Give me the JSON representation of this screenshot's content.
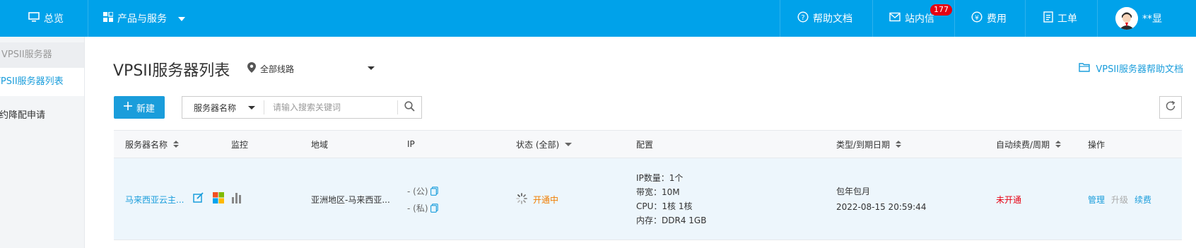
{
  "topbar": {
    "overview": "总览",
    "products": "产品与服务",
    "help_docs": "帮助文档",
    "messages": "站内信",
    "message_count": "177",
    "billing": "费用",
    "tickets": "工单",
    "username": "**显"
  },
  "sidebar": {
    "section": "VPSII服务器",
    "items": [
      {
        "label": "VPSII服务器列表"
      },
      {
        "label": "预约降配申请"
      }
    ]
  },
  "page": {
    "title": "VPSII服务器列表",
    "region": "全部线路",
    "help_link": "VPSII服务器帮助文档"
  },
  "toolbar": {
    "new_label": "新建",
    "search_field": "服务器名称",
    "search_placeholder": "请输入搜索关键词"
  },
  "table": {
    "headers": {
      "name": "服务器名称",
      "monitor": "监控",
      "region": "地域",
      "ip": "IP",
      "status": "状态 (全部)",
      "config": "配置",
      "type_expiry": "类型/到期日期",
      "auto_renew": "自动续费/周期",
      "actions": "操作"
    },
    "rows": [
      {
        "name": "马来西亚云主...",
        "region": "亚洲地区-马来西亚...",
        "ip_public": "- (公)",
        "ip_private": "- (私)",
        "status": "开通中",
        "config": [
          "IP数量：1个",
          "带宽：10M",
          "CPU：1核 1核",
          "内存：DDR4 1GB"
        ],
        "type": "包年包月",
        "expiry": "2022-08-15 20:59:44",
        "auto_renew": "未开通",
        "actions": {
          "manage": "管理",
          "upgrade": "升级",
          "renew": "续费"
        }
      }
    ]
  },
  "colors": {
    "topbar": "#00a2ea",
    "accent": "#1a9ddb",
    "status_pending": "#f07d00",
    "not_enabled": "#e60012",
    "badge": "#e60012"
  }
}
